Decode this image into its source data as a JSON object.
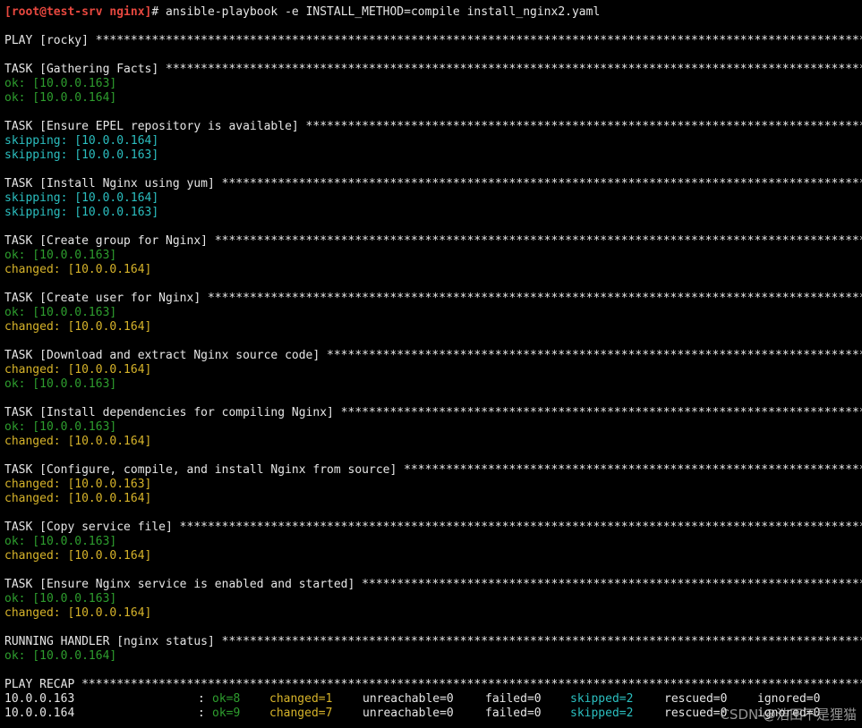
{
  "prompt": "[root@test-srv nginx]",
  "prompt_symbol": "# ",
  "command": "ansible-playbook -e INSTALL_METHOD=compile install_nginx2.yaml",
  "stars": "**********************************************************************************************************************",
  "lines": [
    {
      "type": "blank"
    },
    {
      "type": "header",
      "text": "PLAY [rocky] "
    },
    {
      "type": "blank"
    },
    {
      "type": "header",
      "text": "TASK [Gathering Facts] "
    },
    {
      "type": "ok",
      "text": "ok: [10.0.0.163]"
    },
    {
      "type": "ok",
      "text": "ok: [10.0.0.164]"
    },
    {
      "type": "blank"
    },
    {
      "type": "header",
      "text": "TASK [Ensure EPEL repository is available] "
    },
    {
      "type": "skipping",
      "text": "skipping: [10.0.0.164]"
    },
    {
      "type": "skipping",
      "text": "skipping: [10.0.0.163]"
    },
    {
      "type": "blank"
    },
    {
      "type": "header",
      "text": "TASK [Install Nginx using yum] "
    },
    {
      "type": "skipping",
      "text": "skipping: [10.0.0.164]"
    },
    {
      "type": "skipping",
      "text": "skipping: [10.0.0.163]"
    },
    {
      "type": "blank"
    },
    {
      "type": "header",
      "text": "TASK [Create group for Nginx] "
    },
    {
      "type": "ok",
      "text": "ok: [10.0.0.163]"
    },
    {
      "type": "changed",
      "text": "changed: [10.0.0.164]"
    },
    {
      "type": "blank"
    },
    {
      "type": "header",
      "text": "TASK [Create user for Nginx] "
    },
    {
      "type": "ok",
      "text": "ok: [10.0.0.163]"
    },
    {
      "type": "changed",
      "text": "changed: [10.0.0.164]"
    },
    {
      "type": "blank"
    },
    {
      "type": "header",
      "text": "TASK [Download and extract Nginx source code] "
    },
    {
      "type": "changed",
      "text": "changed: [10.0.0.164]"
    },
    {
      "type": "ok",
      "text": "ok: [10.0.0.163]"
    },
    {
      "type": "blank"
    },
    {
      "type": "header",
      "text": "TASK [Install dependencies for compiling Nginx] "
    },
    {
      "type": "ok",
      "text": "ok: [10.0.0.163]"
    },
    {
      "type": "changed",
      "text": "changed: [10.0.0.164]"
    },
    {
      "type": "blank"
    },
    {
      "type": "header",
      "text": "TASK [Configure, compile, and install Nginx from source] "
    },
    {
      "type": "changed",
      "text": "changed: [10.0.0.163]"
    },
    {
      "type": "changed",
      "text": "changed: [10.0.0.164]"
    },
    {
      "type": "blank"
    },
    {
      "type": "header",
      "text": "TASK [Copy service file] "
    },
    {
      "type": "ok",
      "text": "ok: [10.0.0.163]"
    },
    {
      "type": "changed",
      "text": "changed: [10.0.0.164]"
    },
    {
      "type": "blank"
    },
    {
      "type": "header",
      "text": "TASK [Ensure Nginx service is enabled and started] "
    },
    {
      "type": "ok",
      "text": "ok: [10.0.0.163]"
    },
    {
      "type": "changed",
      "text": "changed: [10.0.0.164]"
    },
    {
      "type": "blank"
    },
    {
      "type": "header",
      "text": "RUNNING HANDLER [nginx status] "
    },
    {
      "type": "ok",
      "text": "ok: [10.0.0.164]"
    },
    {
      "type": "blank"
    },
    {
      "type": "header",
      "text": "PLAY RECAP "
    }
  ],
  "recap": [
    {
      "host": "10.0.0.163",
      "sep": ":",
      "ok": "ok=8",
      "changed": "changed=1",
      "unreachable": "unreachable=0",
      "failed": "failed=0",
      "skipped": "skipped=2",
      "rescued": "rescued=0",
      "ignored": "ignored=0"
    },
    {
      "host": "10.0.0.164",
      "sep": ":",
      "ok": "ok=9",
      "changed": "changed=7",
      "unreachable": "unreachable=0",
      "failed": "failed=0",
      "skipped": "skipped=2",
      "rescued": "rescued=0",
      "ignored": "ignored=0"
    }
  ],
  "watermark": "CSDN @浩田不是狸猫",
  "colors": {
    "background": "#000000",
    "ok": "#2e9e2e",
    "changed": "#d6b32a",
    "skipping": "#2bbfc0",
    "prompt": "#e8483f",
    "text": "#e6e6e6"
  }
}
